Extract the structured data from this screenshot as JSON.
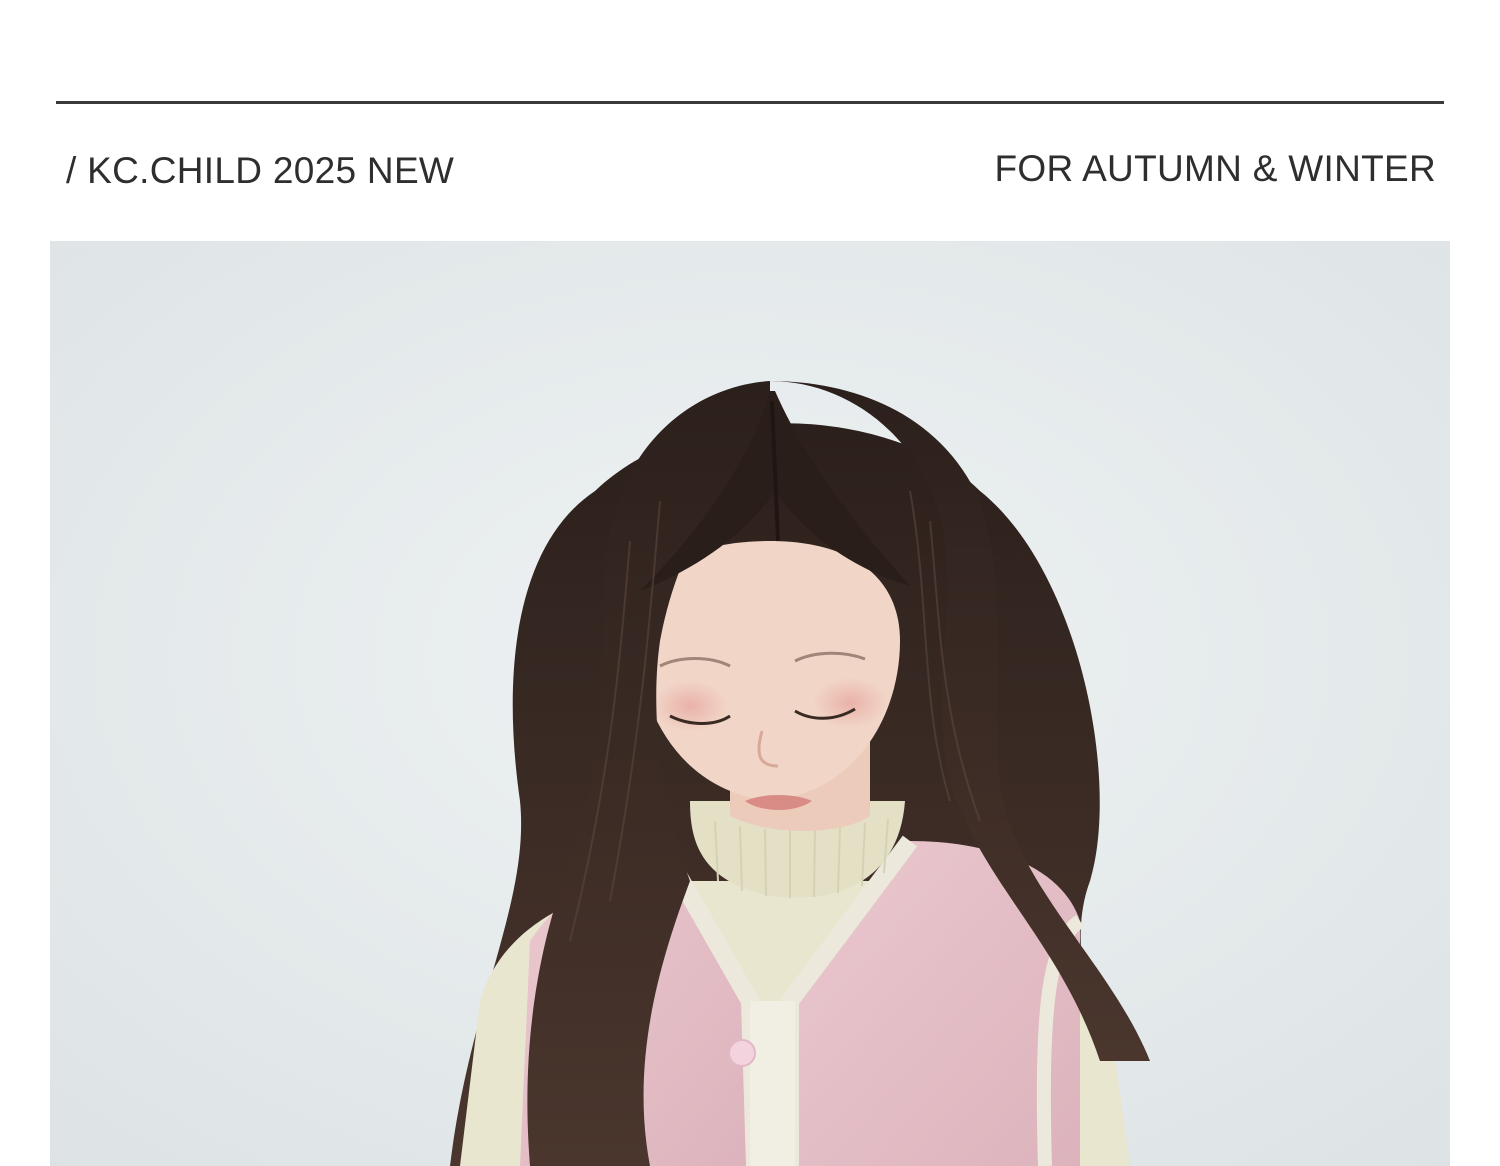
{
  "header": {
    "collection_label": "/ KC.CHILD 2025 NEW",
    "season_label": "FOR AUTUMN & WINTER"
  },
  "hero_photo": {
    "subject": "child-model",
    "colors": {
      "backdrop": "#e3e8ea",
      "hair": "#3a2a24",
      "skin": "#f1d6c8",
      "turtleneck": "#e9e6cf",
      "vest": "#e6c3ca",
      "vest_trim": "#ece9dc",
      "snap_button": "#f3d3de"
    }
  }
}
